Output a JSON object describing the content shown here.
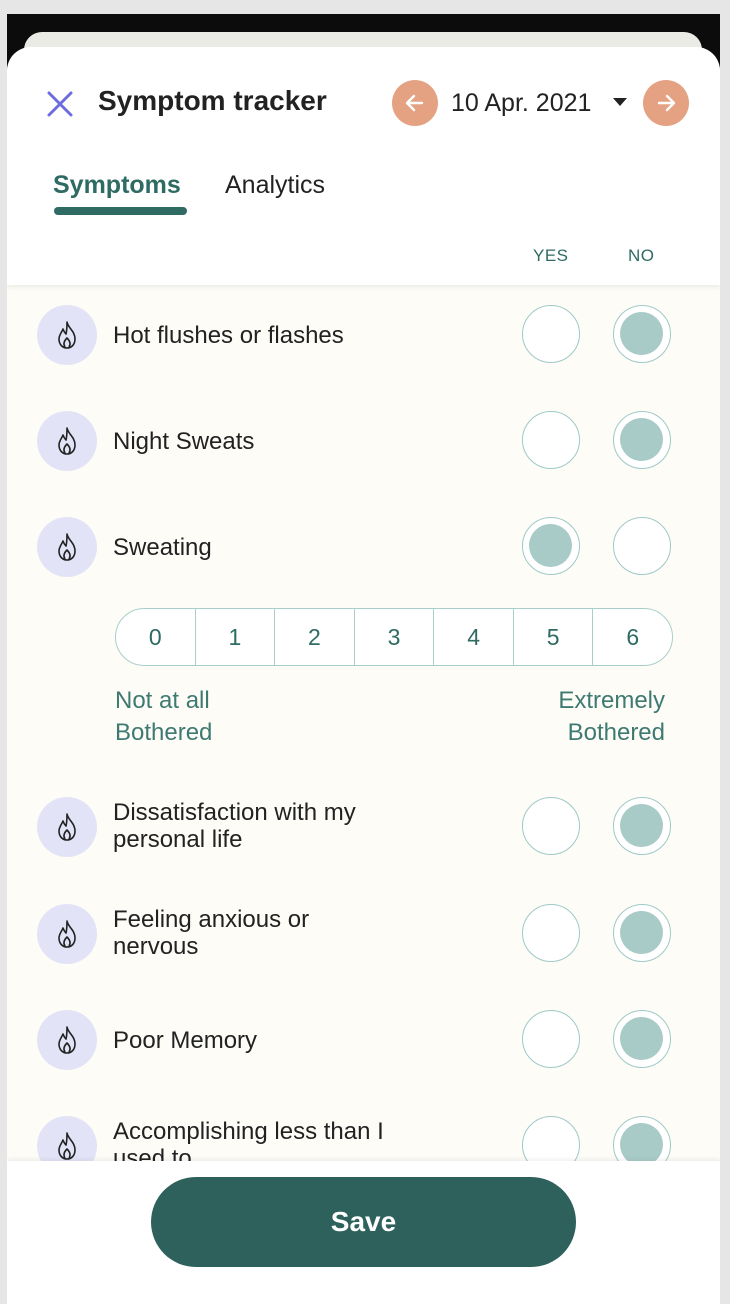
{
  "header": {
    "title": "Symptom tracker",
    "date": "10 Apr. 2021",
    "close_icon": "close-icon",
    "prev_icon": "arrow-left-icon",
    "next_icon": "arrow-right-icon"
  },
  "tabs": [
    {
      "label": "Symptoms",
      "active": true
    },
    {
      "label": "Analytics",
      "active": false
    }
  ],
  "columns": {
    "yes": "YES",
    "no": "NO"
  },
  "symptoms": [
    {
      "label": "Hot flushes or flashes",
      "answer": "no"
    },
    {
      "label": "Night Sweats",
      "answer": "no"
    },
    {
      "label": "Sweating",
      "answer": "yes"
    },
    {
      "label": "Dissatisfaction with my personal life",
      "answer": "no"
    },
    {
      "label": "Feeling anxious or nervous",
      "answer": "no"
    },
    {
      "label": "Poor Memory",
      "answer": "no"
    },
    {
      "label": "Accomplishing less than I used to",
      "answer": "no"
    }
  ],
  "severity_scale": {
    "values": [
      "0",
      "1",
      "2",
      "3",
      "4",
      "5",
      "6"
    ],
    "min_label_line1": "Not at all",
    "min_label_line2": "Bothered",
    "max_label_line1": "Extremely",
    "max_label_line2": "Bothered"
  },
  "footer": {
    "save_label": "Save"
  },
  "colors": {
    "accent": "#2e615b",
    "nav_button": "#e4a283",
    "icon_bg": "#e3e3f7",
    "selected_radio": "#a9cbc7"
  }
}
